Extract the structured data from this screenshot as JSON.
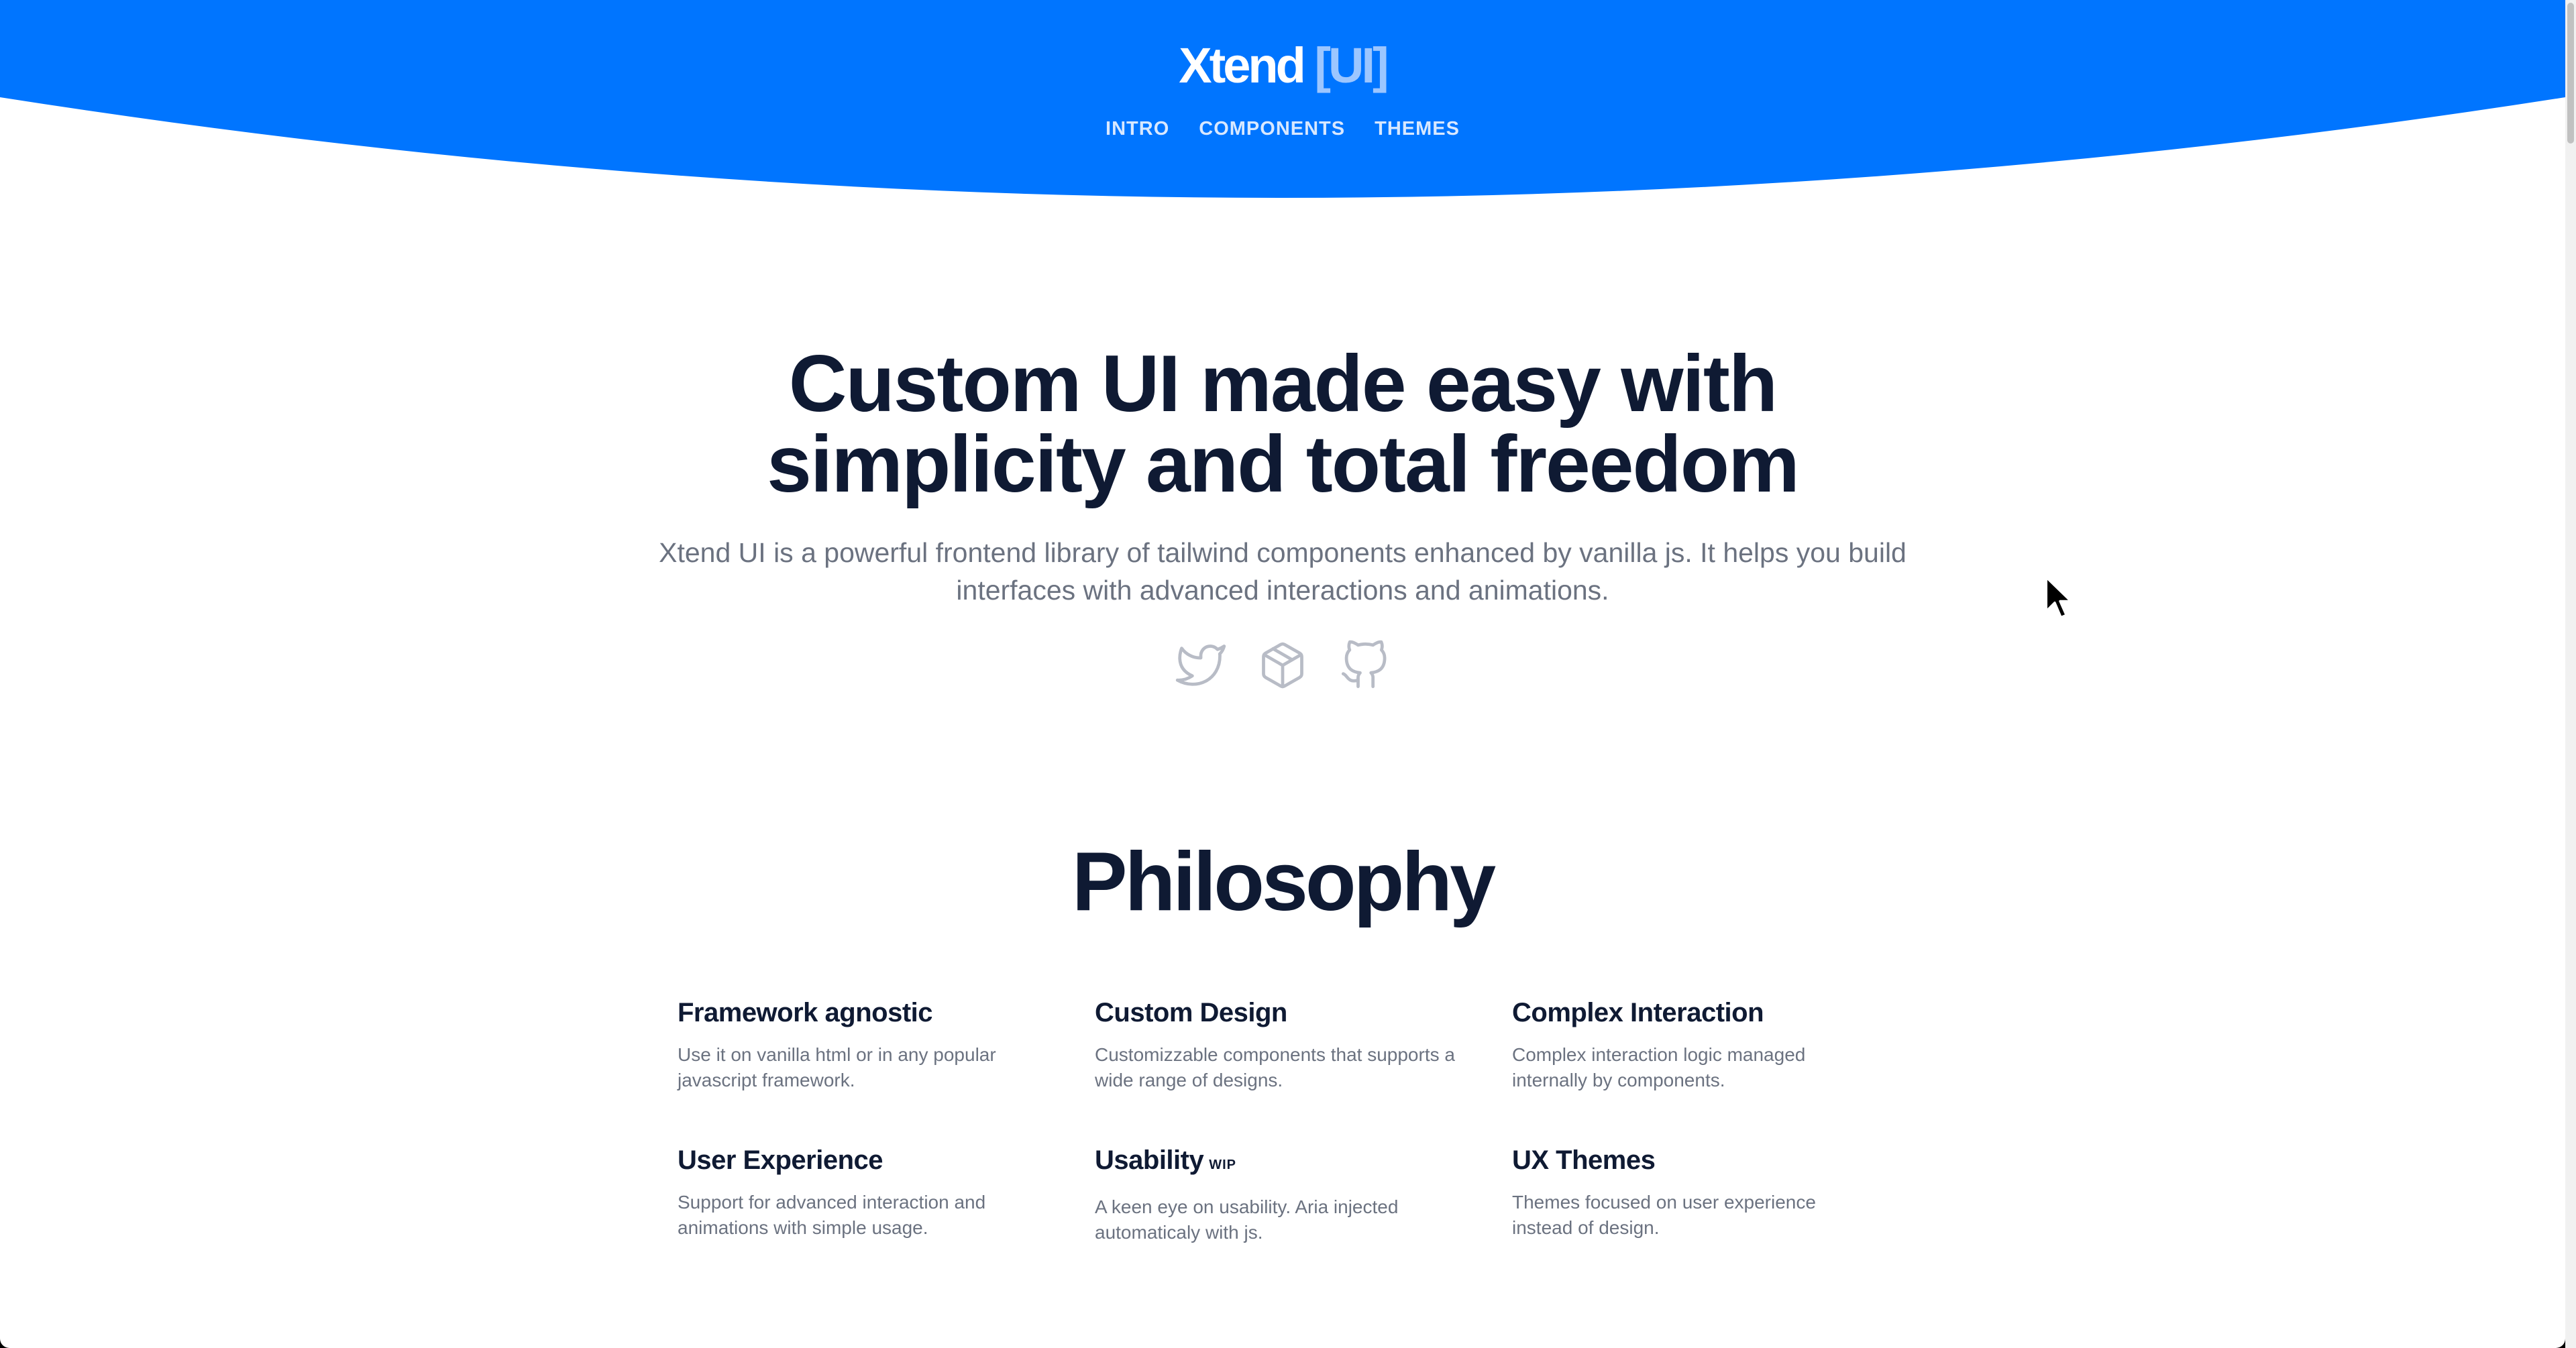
{
  "header": {
    "logo_main": "Xtend",
    "logo_accent": "[UI]",
    "nav": [
      {
        "label": "INTRO"
      },
      {
        "label": "COMPONENTS"
      },
      {
        "label": "THEMES"
      }
    ]
  },
  "hero": {
    "title_line1": "Custom UI made easy with",
    "title_line2": "simplicity and total freedom",
    "description": "Xtend UI is a powerful frontend library of tailwind components enhanced by vanilla js. It helps you build interfaces with advanced interactions and animations.",
    "social": [
      {
        "icon": "twitter-icon"
      },
      {
        "icon": "package-icon"
      },
      {
        "icon": "github-icon"
      }
    ]
  },
  "philosophy": {
    "title": "Philosophy",
    "features": [
      {
        "title": "Framework agnostic",
        "tag": "",
        "text": "Use it on vanilla html or in any popular javascript framework."
      },
      {
        "title": "Custom Design",
        "tag": "",
        "text": "Customizzable components that supports a wide range of designs."
      },
      {
        "title": "Complex Interaction",
        "tag": "",
        "text": "Complex interaction logic managed internally by components."
      },
      {
        "title": "User Experience",
        "tag": "",
        "text": "Support for advanced interaction and animations with simple usage."
      },
      {
        "title": "Usability",
        "tag": "WIP",
        "text": "A keen eye on usability. Aria injected automaticaly with js."
      },
      {
        "title": "UX Themes",
        "tag": "",
        "text": "Themes focused on user experience instead of design."
      }
    ]
  },
  "colors": {
    "brand_blue": "#0075ff",
    "heading": "#0f1a33",
    "muted_text": "#6b7280",
    "icon_gray": "#b8bcc6"
  }
}
